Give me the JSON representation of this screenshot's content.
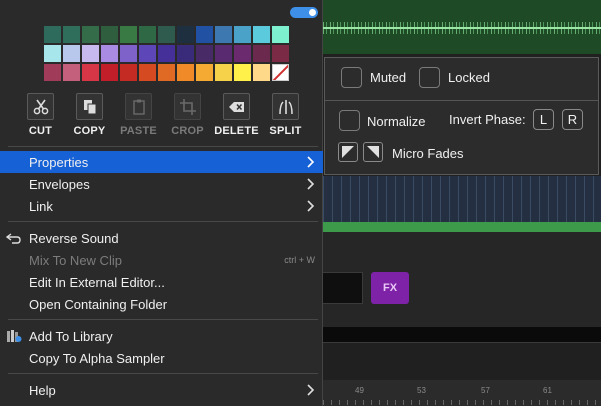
{
  "menu": {
    "colors": [
      "#2e6b5c",
      "#2f6e5a",
      "#346b48",
      "#2f5e3f",
      "#397a44",
      "#2e6844",
      "#2f5a4e",
      "#1e2f3f",
      "#2151a3",
      "#3d79b0",
      "#4aa2c8",
      "#5ccadd",
      "#7df0cf",
      "#a7e6ea",
      "#b8c8ec",
      "#c7b8ee",
      "#a98be4",
      "#7f62c9",
      "#5d47b8",
      "#453099",
      "#3a2a7a",
      "#472a66",
      "#5a2a70",
      "#6c2a6e",
      "#6b2a4d",
      "#7a2a45",
      "#a13b5a",
      "#c45f7c",
      "#d63646",
      "#c21e2a",
      "#c42b22",
      "#d64a22",
      "#e06a24",
      "#f08a28",
      "#f5ab33",
      "#f5d24a",
      "#fff04a",
      "#ffd98a",
      "none"
    ],
    "tools": [
      {
        "label": "CUT",
        "icon": "scissors-icon",
        "enabled": true
      },
      {
        "label": "COPY",
        "icon": "copy-icon",
        "enabled": true
      },
      {
        "label": "PASTE",
        "icon": "clipboard-icon",
        "enabled": false
      },
      {
        "label": "CROP",
        "icon": "crop-icon",
        "enabled": false
      },
      {
        "label": "DELETE",
        "icon": "backspace-icon",
        "enabled": true
      },
      {
        "label": "SPLIT",
        "icon": "split-icon",
        "enabled": true
      }
    ],
    "items": {
      "properties": "Properties",
      "envelopes": "Envelopes",
      "link": "Link",
      "reverse": "Reverse Sound",
      "mix": "Mix To New Clip",
      "mix_shortcut": "ctrl + W",
      "edit_external": "Edit In External Editor...",
      "open_folder": "Open Containing Folder",
      "add_library": "Add To Library",
      "copy_alpha": "Copy To Alpha Sampler",
      "help": "Help"
    }
  },
  "submenu": {
    "muted": "Muted",
    "locked": "Locked",
    "normalize": "Normalize",
    "invert_phase": "Invert Phase:",
    "left": "L",
    "right": "R",
    "micro_fades": "Micro Fades"
  },
  "daw": {
    "fx_label": "FX",
    "ruler": [
      "49",
      "53",
      "57",
      "61"
    ]
  },
  "accent": "#1761d6"
}
